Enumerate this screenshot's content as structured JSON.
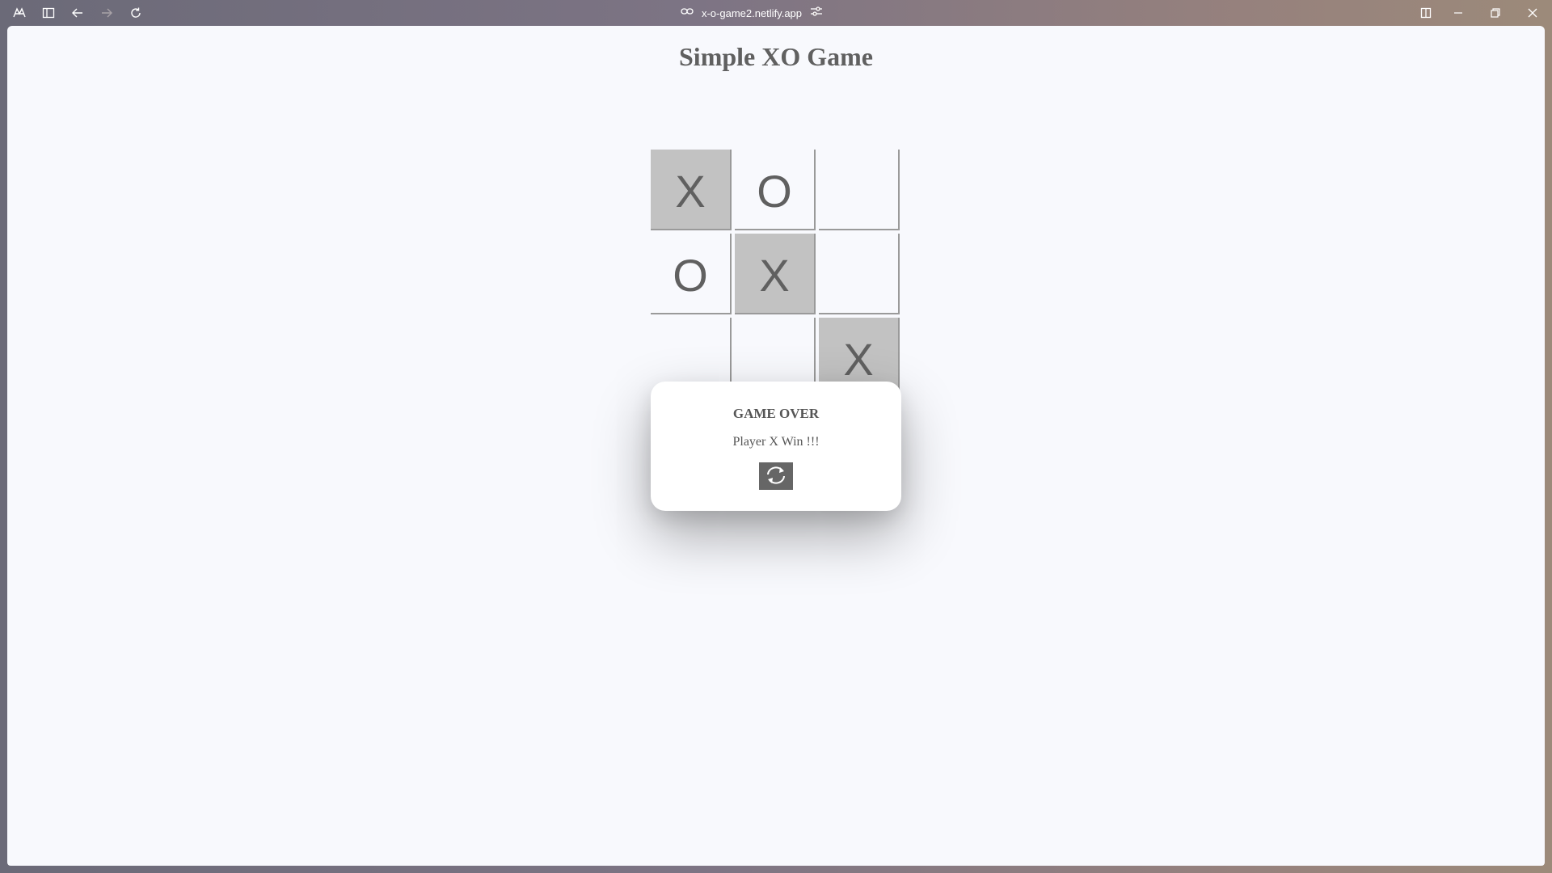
{
  "browser": {
    "url": "x-o-game2.netlify.app",
    "icons": [
      "app-menu-icon",
      "sidebar-icon",
      "back-arrow-icon",
      "forward-arrow-icon",
      "reload-icon",
      "link-icon",
      "site-settings-icon",
      "split-view-icon",
      "minimize-icon",
      "restore-icon",
      "close-icon"
    ]
  },
  "page": {
    "title": "Simple XO Game"
  },
  "board": {
    "cells": [
      "X",
      "O",
      "",
      "O",
      "X",
      "",
      "",
      "",
      "X"
    ],
    "winning_cells": [
      0,
      4,
      8
    ],
    "win_color": "#c2c2c2"
  },
  "modal": {
    "title": "GAME OVER",
    "message": "Player X Win !!!",
    "restart_icon": "refresh-icon"
  },
  "colors": {
    "page_background": "#f8f9fd",
    "text": "#606060",
    "button": "#666666"
  }
}
